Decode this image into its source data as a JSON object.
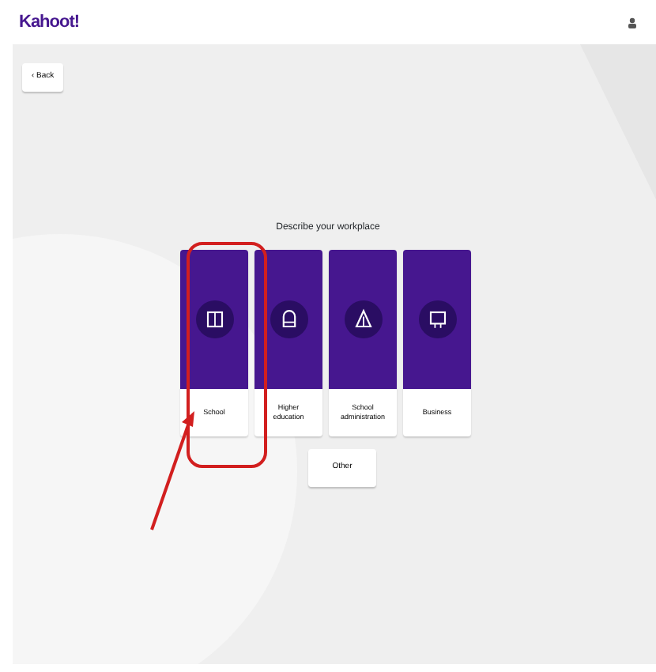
{
  "header": {
    "logo": "Kahoot!"
  },
  "back_button": {
    "label": "‹ Back"
  },
  "title": "Describe your workplace",
  "options": [
    {
      "label": "School",
      "highlighted": true
    },
    {
      "label": "Higher education",
      "highlighted": false
    },
    {
      "label": "School administration",
      "highlighted": false
    },
    {
      "label": "Business",
      "highlighted": false
    }
  ],
  "other_button": {
    "label": "Other"
  }
}
